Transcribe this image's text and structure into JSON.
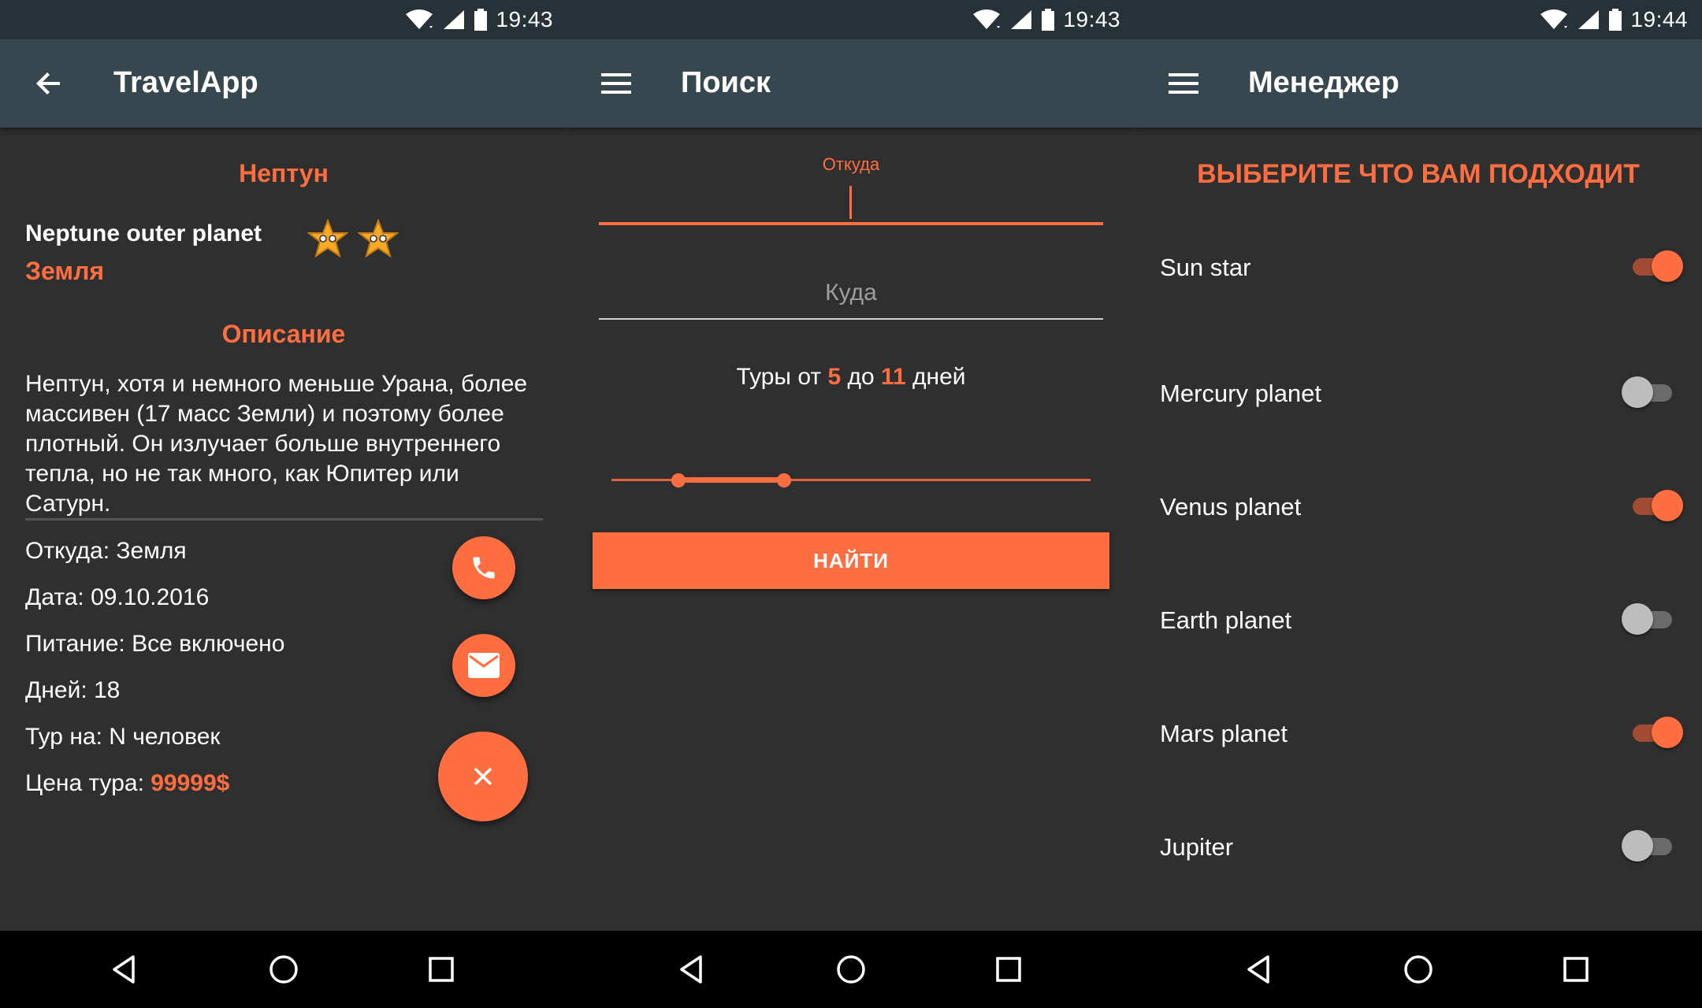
{
  "status_bars": [
    {
      "time": "19:43"
    },
    {
      "time": "19:43"
    },
    {
      "time": "19:44"
    }
  ],
  "screen1": {
    "appbar_title": "TravelApp",
    "nav_icon": "arrow-back-icon",
    "heading": "Нептун",
    "name": "Neptune outer planet",
    "subtitle": "Земля",
    "rating_icons": [
      "star-icon",
      "star-icon"
    ],
    "description_title": "Описание",
    "description": "Нептун, хотя и немного меньше Урана, более массивен (17 масс Земли) и поэтому более плотный. Он излучает больше внутреннего тепла, но не так много, как Юпитер или Сатурн.",
    "info": {
      "from": "Откуда: Земля",
      "date": "Дата: 09.10.2016",
      "meals": "Питание: Все включено",
      "days": "Дней: 18",
      "people": "Тур на: N человек",
      "price_label": "Цена тура: ",
      "price_value": "99999$"
    },
    "fab_icons": [
      "phone-icon",
      "mail-icon",
      "close-icon"
    ]
  },
  "screen2": {
    "appbar_title": "Поиск",
    "nav_icon": "menu-icon",
    "from_label": "Откуда",
    "from_value": "",
    "to_placeholder": "Куда",
    "range_text": {
      "prefix": "Туры от ",
      "min": "5",
      "middle": " до ",
      "max": "11",
      "suffix": " дней"
    },
    "range_min_fraction": 0.14,
    "range_max_fraction": 0.36,
    "search_button": "НАЙТИ"
  },
  "screen3": {
    "appbar_title": "Менеджер",
    "nav_icon": "menu-icon",
    "heading": "ВЫБЕРИТЕ ЧТО ВАМ ПОДХОДИТ",
    "options": [
      {
        "label": "Sun star",
        "on": true
      },
      {
        "label": "Mercury planet",
        "on": false
      },
      {
        "label": "Venus planet",
        "on": true
      },
      {
        "label": "Earth planet",
        "on": false
      },
      {
        "label": "Mars planet",
        "on": true
      },
      {
        "label": "Jupiter",
        "on": false
      }
    ]
  },
  "colors": {
    "accent": "#ff6e40",
    "appbar": "#37474f",
    "statusbar": "#263238",
    "background": "#2f2f2f"
  }
}
